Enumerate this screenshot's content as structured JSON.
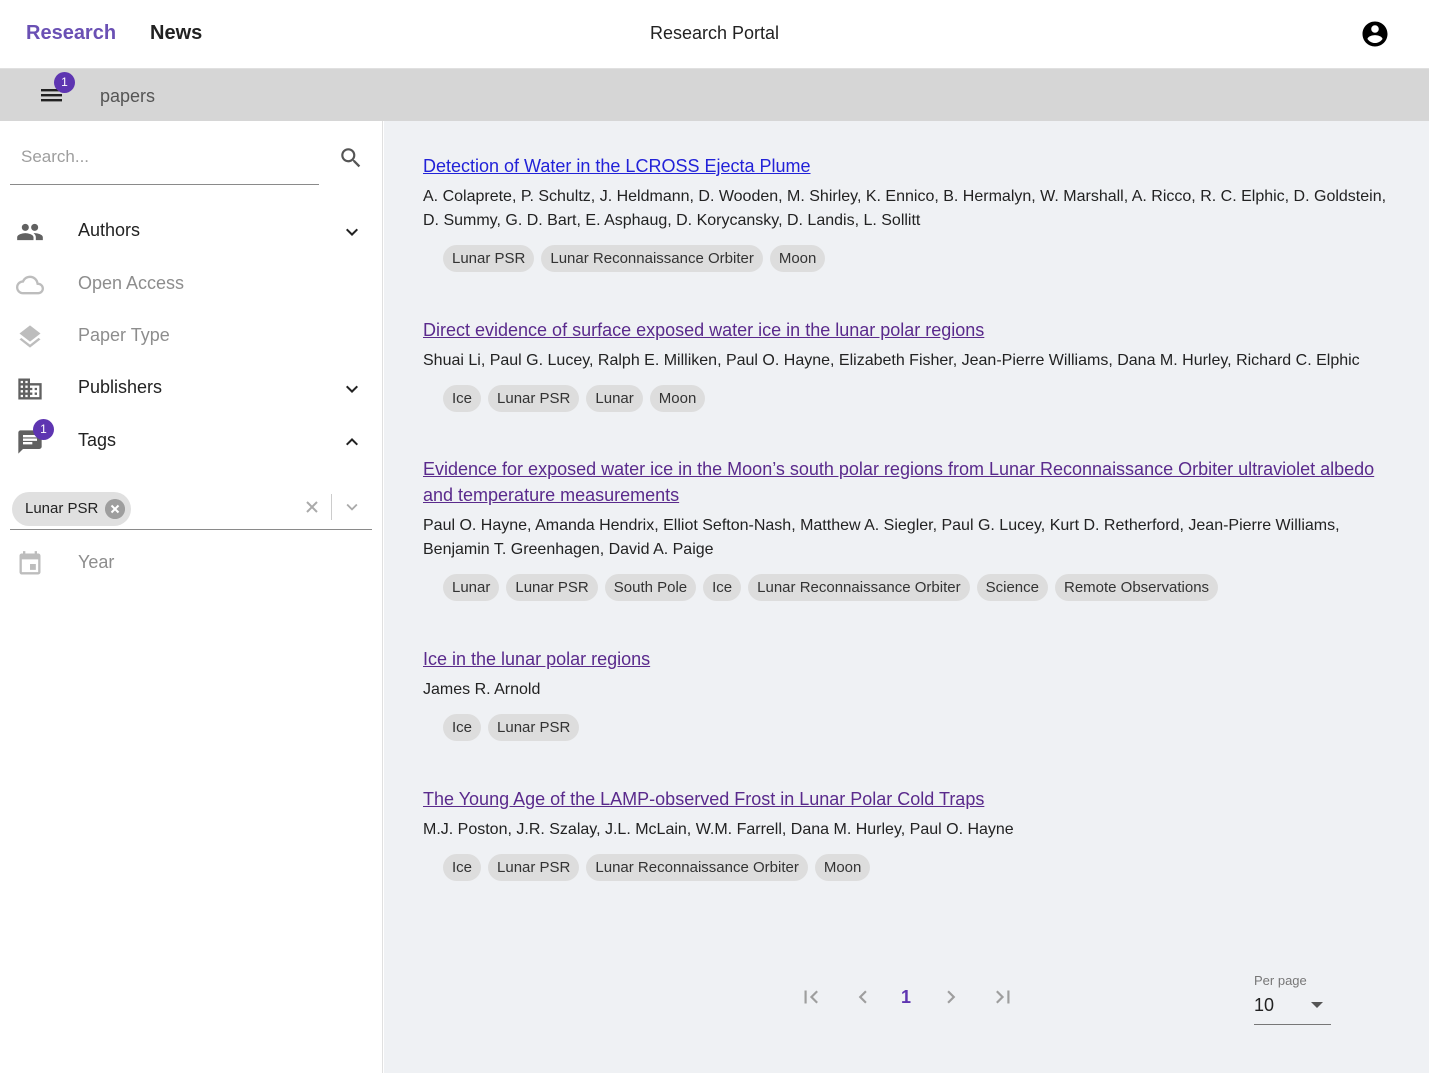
{
  "header": {
    "nav": [
      {
        "label": "Research",
        "active": true
      },
      {
        "label": "News",
        "active": false
      }
    ],
    "title": "Research Portal",
    "account_icon": "account-circle-icon"
  },
  "toolbar": {
    "menu_icon": "menu-icon",
    "menu_badge": "1",
    "title": "papers"
  },
  "sidebar": {
    "search": {
      "placeholder": "Search...",
      "value": ""
    },
    "facets": [
      {
        "label": "Authors",
        "icon": "people-icon",
        "expandable": true,
        "expanded": false,
        "enabled": true
      },
      {
        "label": "Open Access",
        "icon": "cloud-icon",
        "expandable": false,
        "enabled": false
      },
      {
        "label": "Paper Type",
        "icon": "layers-icon",
        "expandable": false,
        "enabled": false
      },
      {
        "label": "Publishers",
        "icon": "building-icon",
        "expandable": true,
        "expanded": false,
        "enabled": true
      },
      {
        "label": "Tags",
        "icon": "comment-icon",
        "expandable": true,
        "expanded": true,
        "enabled": true,
        "badge": "1"
      },
      {
        "label": "Year",
        "icon": "calendar-icon",
        "expandable": false,
        "enabled": false
      }
    ],
    "tags_filter": {
      "selected": [
        "Lunar PSR"
      ]
    }
  },
  "papers": [
    {
      "title": "Detection of Water in the LCROSS Ejecta Plume",
      "visited": false,
      "authors": "A. Colaprete, P. Schultz, J. Heldmann, D. Wooden, M. Shirley, K. Ennico, B. Hermalyn, W. Marshall, A. Ricco, R. C. Elphic, D. Goldstein, D. Summy, G. D. Bart, E. Asphaug, D. Korycansky, D. Landis, L. Sollitt",
      "tags": [
        "Lunar PSR",
        "Lunar Reconnaissance Orbiter",
        "Moon"
      ]
    },
    {
      "title": "Direct evidence of surface exposed water ice in the lunar polar regions",
      "visited": true,
      "authors": "Shuai Li, Paul G. Lucey, Ralph E. Milliken, Paul O. Hayne, Elizabeth Fisher, Jean-Pierre Williams, Dana M. Hurley, Richard C. Elphic",
      "tags": [
        "Ice",
        "Lunar PSR",
        "Lunar",
        "Moon"
      ]
    },
    {
      "title": "Evidence for exposed water ice in the Moon’s south polar regions from Lunar Reconnaissance Orbiter ultraviolet albedo and temperature measurements",
      "visited": true,
      "authors": "Paul O. Hayne, Amanda Hendrix, Elliot Sefton-Nash, Matthew A. Siegler, Paul G. Lucey, Kurt D. Retherford, Jean-Pierre Williams, Benjamin T. Greenhagen, David A. Paige",
      "tags": [
        "Lunar",
        "Lunar PSR",
        "South Pole",
        "Ice",
        "Lunar Reconnaissance Orbiter",
        "Science",
        "Remote Observations"
      ]
    },
    {
      "title": "Ice in the lunar polar regions",
      "visited": true,
      "authors": "James R. Arnold",
      "tags": [
        "Ice",
        "Lunar PSR"
      ]
    },
    {
      "title": "The Young Age of the LAMP-observed Frost in Lunar Polar Cold Traps",
      "visited": true,
      "authors": "M.J. Poston, J.R. Szalay, J.L. McLain, W.M. Farrell, Dana M. Hurley, Paul O. Hayne",
      "tags": [
        "Ice",
        "Lunar PSR",
        "Lunar Reconnaissance Orbiter",
        "Moon"
      ]
    }
  ],
  "pagination": {
    "current_page": "1",
    "per_page_label": "Per page",
    "per_page_value": "10"
  },
  "colors": {
    "accent": "#5e35b1",
    "nav_active": "#6a50b4",
    "link_visited": "#5a2a8c",
    "link_unvisited": "#2222d8",
    "toolbar_bg": "#d6d6d6",
    "main_bg": "#eff1f4"
  }
}
